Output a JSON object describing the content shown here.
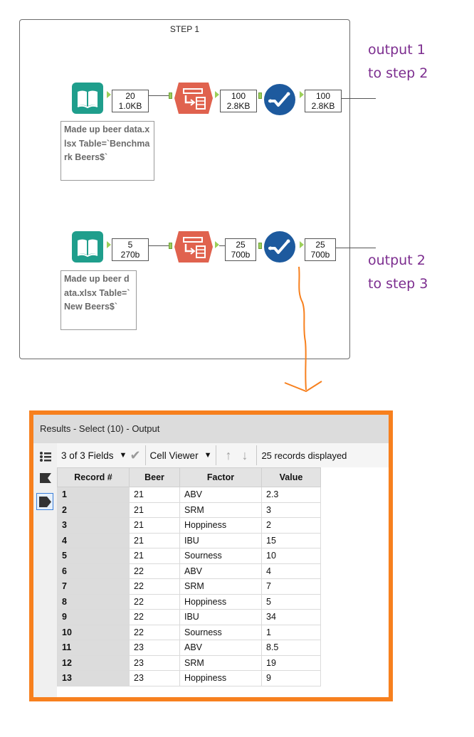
{
  "workflow": {
    "container_title": "STEP 1",
    "row1": {
      "input_badge": [
        "20",
        "1.0KB"
      ],
      "transpose_badge": [
        "100",
        "2.8KB"
      ],
      "select_badge": [
        "100",
        "2.8KB"
      ],
      "annotation": "Made up beer data.xlsx Table=`Benchmark Beers$`"
    },
    "row2": {
      "input_badge": [
        "5",
        "270b"
      ],
      "transpose_badge": [
        "25",
        "700b"
      ],
      "select_badge": [
        "25",
        "700b"
      ],
      "annotation": "Made up beer data.xlsx Table=`New Beers$`"
    },
    "output_notes": [
      [
        "output 1",
        "to step 2"
      ],
      [
        "output 2",
        "to step 3"
      ]
    ],
    "colors": {
      "input_tool": "#1f9e8c",
      "transpose_tool": "#e0624e",
      "select_tool": "#1d5a9e",
      "note_text": "#7c2d8f",
      "highlight_arrow": "#f7801e"
    }
  },
  "results": {
    "title": "Results - Select (10) - Output",
    "fields_label": "3 of 3 Fields",
    "viewer_label": "Cell Viewer",
    "records_label": "25 records displayed",
    "columns": [
      "Record #",
      "Beer",
      "Factor",
      "Value"
    ],
    "rows": [
      [
        "1",
        "21",
        "ABV",
        "2.3"
      ],
      [
        "2",
        "21",
        "SRM",
        "3"
      ],
      [
        "3",
        "21",
        "Hoppiness",
        "2"
      ],
      [
        "4",
        "21",
        "IBU",
        "15"
      ],
      [
        "5",
        "21",
        "Sourness",
        "10"
      ],
      [
        "6",
        "22",
        "ABV",
        "4"
      ],
      [
        "7",
        "22",
        "SRM",
        "7"
      ],
      [
        "8",
        "22",
        "Hoppiness",
        "5"
      ],
      [
        "9",
        "22",
        "IBU",
        "34"
      ],
      [
        "10",
        "22",
        "Sourness",
        "1"
      ],
      [
        "11",
        "23",
        "ABV",
        "8.5"
      ],
      [
        "12",
        "23",
        "SRM",
        "19"
      ],
      [
        "13",
        "23",
        "Hoppiness",
        "9"
      ]
    ]
  }
}
